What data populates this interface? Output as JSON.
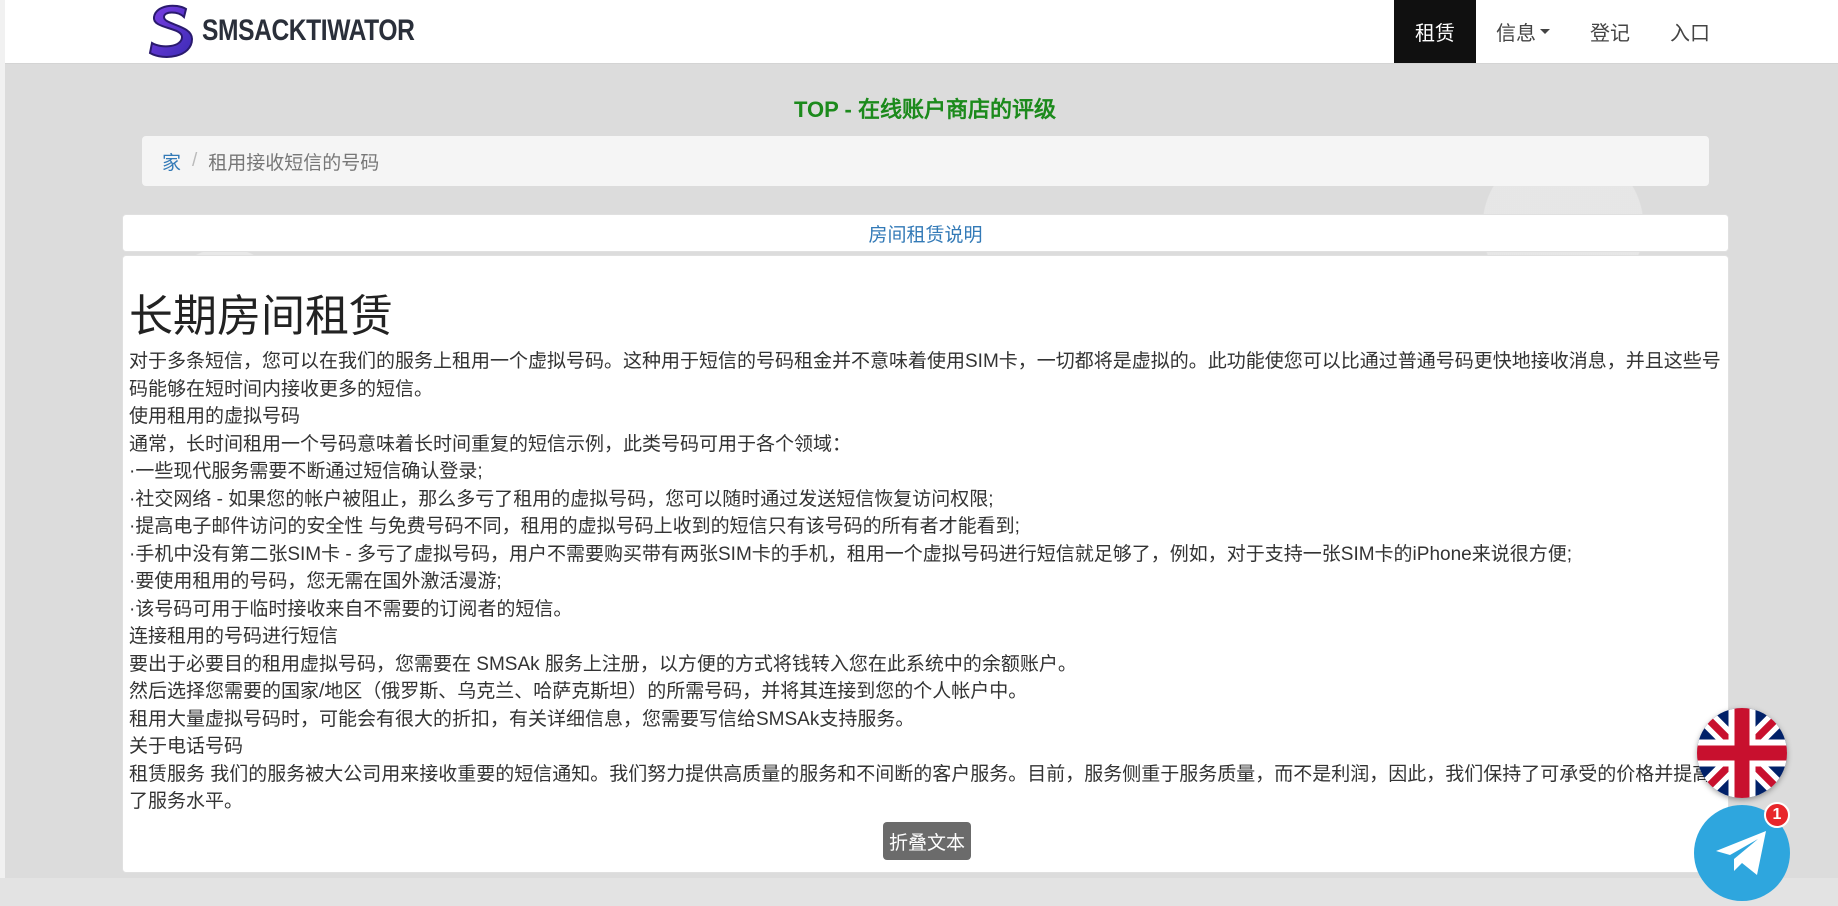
{
  "colors": {
    "nav_active_bg": "#101010",
    "top_title": "#1c8a1c",
    "link": "#337ab7",
    "collapse_button_bg": "#6b6b6b",
    "telegram": "#2ea6de",
    "badge": "#e8262b"
  },
  "header": {
    "logo_sms": "SMS",
    "logo_rest": "ACKTIWATOR",
    "nav": [
      {
        "label": "租赁",
        "active": true
      },
      {
        "label": "信息",
        "dropdown": true
      },
      {
        "label": "登记"
      },
      {
        "label": "入口"
      }
    ]
  },
  "top_title": "TOP - 在线账户商店的评级",
  "breadcrumb": {
    "home": "家",
    "separator": "/",
    "current": "租用接收短信的号码"
  },
  "info_tab": "房间租赁说明",
  "article": {
    "title": "长期房间租赁",
    "paragraphs": [
      "对于多条短信，您可以在我们的服务上租用一个虚拟号码。这种用于短信的号码租金并不意味着使用SIM卡，一切都将是虚拟的。此功能使您可以比通过普通号码更快地接收消息，并且这些号码能够在短时间内接收更多的短信。",
      "使用租用的虚拟号码",
      "通常，长时间租用一个号码意味着长时间重复的短信示例，此类号码可用于各个领域：",
      "·一些现代服务需要不断通过短信确认登录;",
      "·社交网络 - 如果您的帐户被阻止，那么多亏了租用的虚拟号码，您可以随时通过发送短信恢复访问权限;",
      "·提高电子邮件访问的安全性 与免费号码不同，租用的虚拟号码上收到的短信只有该号码的所有者才能看到;",
      "·手机中没有第二张SIM卡 - 多亏了虚拟号码，用户不需要购买带有两张SIM卡的手机，租用一个虚拟号码进行短信就足够了，例如，对于支持一张SIM卡的iPhone来说很方便;",
      "·要使用租用的号码，您无需在国外激活漫游;",
      "·该号码可用于临时接收来自不需要的订阅者的短信。",
      "连接租用的号码进行短信",
      "要出于必要目的租用虚拟号码，您需要在 SMSAk 服务上注册，以方便的方式将钱转入您在此系统中的余额账户。",
      "然后选择您需要的国家/地区（俄罗斯、乌克兰、哈萨克斯坦）的所需号码，并将其连接到您的个人帐户中。",
      "租用大量虚拟号码时，可能会有很大的折扣，有关详细信息，您需要写信给SMSAk支持服务。",
      "关于电话号码",
      "租赁服务 我们的服务被大公司用来接收重要的短信通知。我们努力提供高质量的服务和不间断的客户服务。目前，服务侧重于服务质量，而不是利润，因此，我们保持了可承受的价格并提高了服务水平。"
    ],
    "collapse_label": "折叠文本"
  },
  "floating": {
    "language_icon": "uk-flag-icon",
    "telegram_icon": "telegram-icon",
    "telegram_badge": "1"
  }
}
